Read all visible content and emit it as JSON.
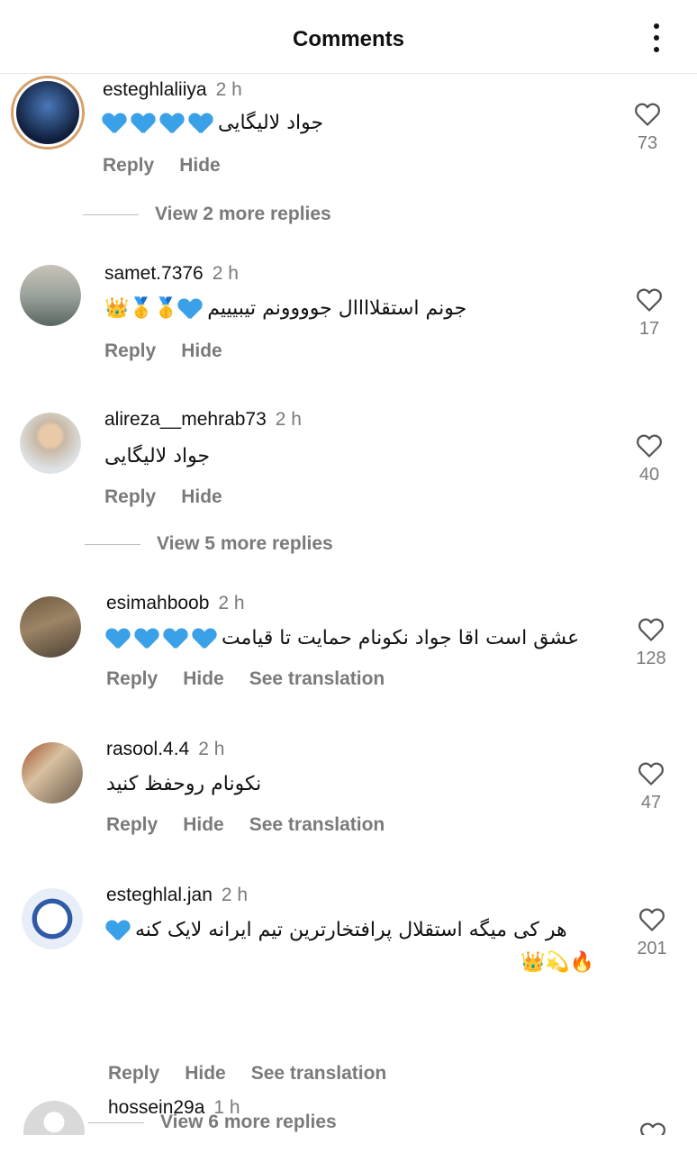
{
  "header": {
    "title": "Comments"
  },
  "colors": {
    "accent_blue": "#3aa0e8",
    "meta_gray": "#7a7a7a"
  },
  "labels": {
    "reply": "Reply",
    "hide": "Hide",
    "see_translation": "See translation"
  },
  "comments": [
    {
      "username": "esteghlaliiya",
      "time": "2 h",
      "text": "جواد لالیگایی",
      "likes": "73",
      "replies": "View 2 more replies"
    },
    {
      "username": "samet.7376",
      "time": "2 h",
      "text": "جونم استقلاااال جوووونم تیبیییم",
      "likes": "17"
    },
    {
      "username": "alireza__mehrab73",
      "time": "2 h",
      "text": "جواد لالیگایی",
      "likes": "40",
      "replies": "View 5 more replies"
    },
    {
      "username": "esimahboob",
      "time": "2 h",
      "text": "عشق است اقا جواد نکونام حمایت تا قیامت",
      "likes": "128"
    },
    {
      "username": "rasool.4.4",
      "time": "2 h",
      "text": "نکونام روحفظ کنید",
      "likes": "47"
    },
    {
      "username": "esteghlal.jan",
      "time": "2 h",
      "text": "هر کی میگه استقلال پرافتخارترین تیم ایرانه لایک کنه",
      "likes": "201",
      "replies": "View 6 more replies"
    },
    {
      "username": "hossein29a",
      "time": "1 h"
    }
  ]
}
